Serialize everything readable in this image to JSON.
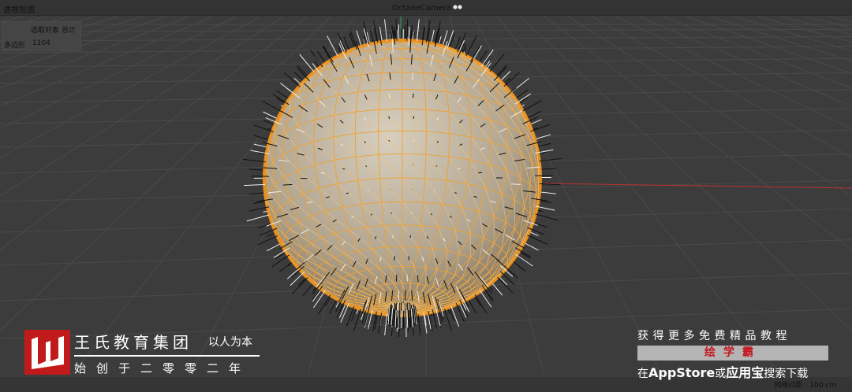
{
  "viewport": {
    "title": "透视视图",
    "camera": "OctaneCamera",
    "camera_icon": "octane-camera-icon"
  },
  "stats": {
    "header": "选取对象 总计",
    "row_label": "多边形",
    "row_value": "1104"
  },
  "status": {
    "grid_spacing": "网格间距 : 100 cm"
  },
  "watermark": {
    "name": "王氏教育集团",
    "motto": "以人为本",
    "founded": "始创于二零零二年",
    "logo": "wangshi-w-logo"
  },
  "promo": {
    "line1": "获得更多免费精品教程",
    "app": "绘学霸",
    "line3_prefix": "在",
    "line3_store": "AppStore",
    "line3_or": "或",
    "line3_store2": "应用宝",
    "line3_suffix": "搜索下载"
  },
  "colors": {
    "background": "#3c3c3c",
    "wireframe": "#f0a030",
    "logo_red": "#c01a1a",
    "x_axis": "#c03030",
    "y_axis": "#30a060"
  }
}
